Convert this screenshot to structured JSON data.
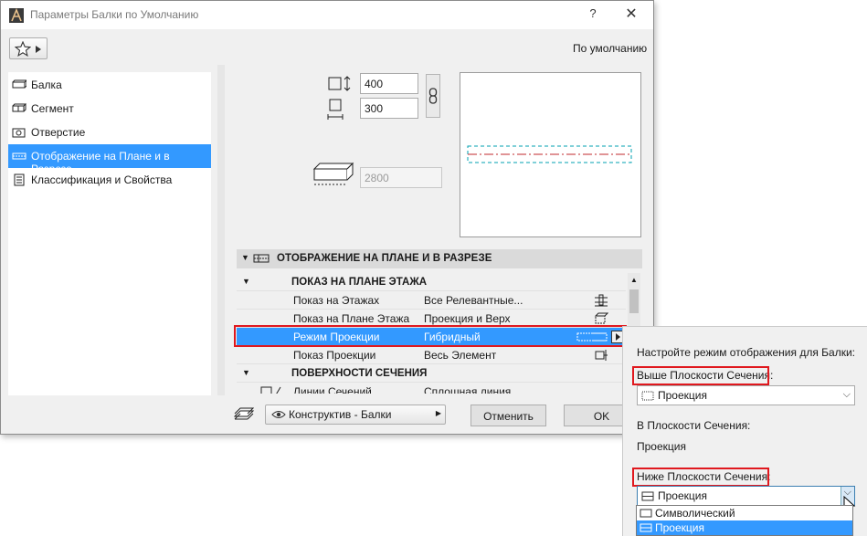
{
  "window": {
    "title": "Параметры Балки по Умолчанию",
    "help_glyph": "?",
    "close_glyph": "✕",
    "default_label": "По умолчанию"
  },
  "sidebar": {
    "items": [
      {
        "label": "Балка",
        "icon": "beam-icon"
      },
      {
        "label": "Сегмент",
        "icon": "segment-icon"
      },
      {
        "label": "Отверстие",
        "icon": "hole-icon"
      },
      {
        "label": "Отображение на Плане и в Разрезе",
        "icon": "floor-plan-display-icon",
        "selected": true
      },
      {
        "label": "Классификация и Свойства",
        "icon": "classification-icon"
      }
    ]
  },
  "geometry": {
    "height_value": "400",
    "width_value": "300",
    "elevation_value": "2800"
  },
  "section": {
    "title": "ОТОБРАЖЕНИЕ НА ПЛАНЕ И В РАЗРЕЗЕ",
    "groups": [
      {
        "title": "ПОКАЗ НА ПЛАНЕ ЭТАЖА",
        "rows": [
          {
            "label": "Показ на Этажах",
            "value": "Все Релевантные..."
          },
          {
            "label": "Показ на Плане Этажа",
            "value": "Проекция и Верх"
          },
          {
            "label": "Режим Проекции",
            "value": "Гибридный"
          },
          {
            "label": "Показ Проекции",
            "value": "Весь Элемент"
          }
        ]
      },
      {
        "title": "ПОВЕРХНОСТИ СЕЧЕНИЯ",
        "rows": [
          {
            "label": "Линии Сечений",
            "value": "Сплошная линия"
          }
        ]
      }
    ]
  },
  "footer": {
    "layer": "Конструктив - Балки",
    "cancel_label": "Отменить",
    "ok_label": "OK"
  },
  "popup": {
    "heading": "Настройте режим отображения для Балки:",
    "above_label": "Выше Плоскости Сечения:",
    "above_value": "Проекция",
    "in_label": "В Плоскости Сечения:",
    "in_value": "Проекция",
    "below_label": "Ниже Плоскости Сечения:",
    "below_value": "Проекция",
    "options": [
      "Символический",
      "Проекция"
    ]
  },
  "colors": {
    "selection": "#3399ff",
    "highlight_red": "#e0181e",
    "preview_line": "#00a0b0",
    "axis_line": "#c0282d"
  }
}
